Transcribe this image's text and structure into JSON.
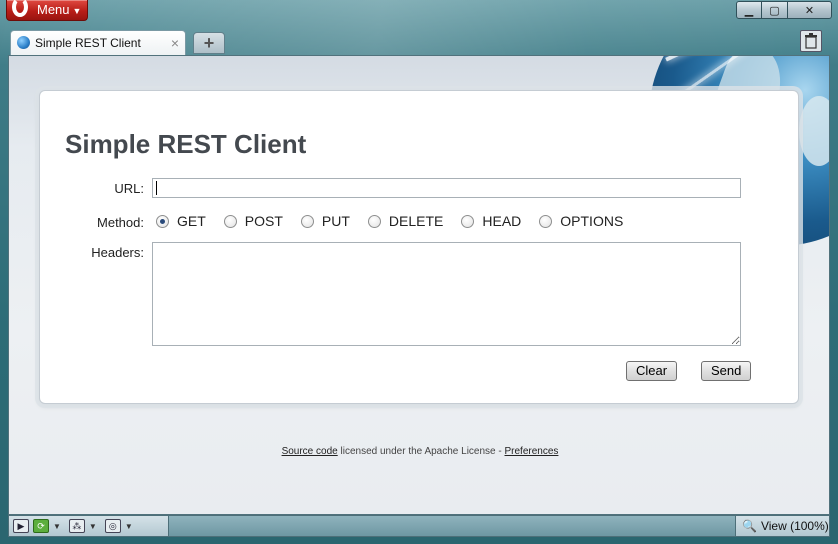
{
  "titlebar": {
    "menu_label": "Menu",
    "controls": [
      "minimize",
      "maximize",
      "close"
    ]
  },
  "tabs": [
    {
      "label": "Simple REST Client",
      "active": true
    }
  ],
  "page": {
    "title": "Simple REST Client",
    "url_label": "URL:",
    "url_value": "",
    "method_label": "Method:",
    "methods": [
      "GET",
      "POST",
      "PUT",
      "DELETE",
      "HEAD",
      "OPTIONS"
    ],
    "selected_method": "GET",
    "headers_label": "Headers:",
    "headers_value": "",
    "clear_label": "Clear",
    "send_label": "Send",
    "footer": {
      "source_link": "Source code",
      "middle_text": " licensed under the Apache License - ",
      "prefs_link": "Preferences"
    }
  },
  "statusbar": {
    "zoom_label": "View (100%)"
  },
  "colors": {
    "menu_red": "#b81e18",
    "title_gray": "#44494f",
    "chrome_teal": "#2d6c77"
  },
  "icons": [
    "opera-logo-icon",
    "globe-icon",
    "close-tab-icon",
    "new-tab-icon",
    "trash-icon",
    "panel-toggle-icon",
    "sync-icon",
    "share-icon",
    "turbo-icon",
    "zoom-icon"
  ]
}
